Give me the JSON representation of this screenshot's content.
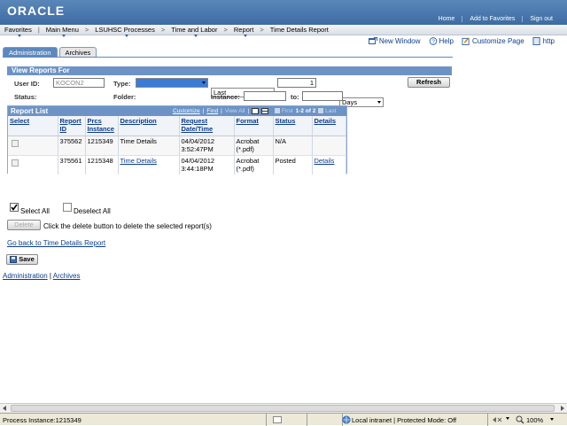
{
  "banner": {
    "logo": "ORACLE",
    "links": [
      "Home",
      "Add to Favorites",
      "Sign out"
    ]
  },
  "menu": {
    "items": [
      "Favorites",
      "Main Menu",
      "LSUHSC Processes",
      "Time and Labor",
      "Report",
      "Time Details Report"
    ]
  },
  "toplinks": {
    "new_window": "New Window",
    "help": "Help",
    "customize": "Customize Page",
    "http": "http"
  },
  "tabs": {
    "administration": "Administration",
    "archives": "Archives"
  },
  "filter": {
    "title": "View Reports For",
    "user_id_label": "User ID:",
    "user_id_value": "KOCON2",
    "type_label": "Type:",
    "type_value": "",
    "last_value": "Last",
    "days_count": "1",
    "days_unit": "Days",
    "refresh": "Refresh",
    "status_label": "Status:",
    "status_value": "",
    "folder_label": "Folder:",
    "folder_value": "",
    "instance_label": "Instance:",
    "instance_value": "",
    "to_label": "to:",
    "to_value": ""
  },
  "report_list": {
    "title": "Report List",
    "nav": {
      "customize": "Customize",
      "find": "Find",
      "view_all": "View All",
      "first": "First",
      "range": "1-2 of 2",
      "last": "Last"
    },
    "columns": {
      "select": "Select",
      "report_id": "Report ID",
      "prcs_instance": "Prcs Instance",
      "description": "Description",
      "request_datetime": "Request Date/Time",
      "format": "Format",
      "status": "Status",
      "details": "Details"
    },
    "rows": [
      {
        "report_id": "375562",
        "prcs_instance": "1215349",
        "description": "Time Details",
        "request_date": "04/04/2012",
        "request_time": "3:52:47PM",
        "format_1": "Acrobat",
        "format_2": "(*.pdf)",
        "status": "N/A",
        "details": ""
      },
      {
        "report_id": "375561",
        "prcs_instance": "1215348",
        "description": "Time Details",
        "request_date": "04/04/2012",
        "request_time": "3:44:18PM",
        "format_1": "Acrobat",
        "format_2": "(*.pdf)",
        "status": "Posted",
        "details": "Details"
      }
    ]
  },
  "actions": {
    "select_all": "Select All",
    "deselect_all": "Deselect All",
    "delete": "Delete",
    "delete_hint": "Click the delete button to delete the selected report(s)",
    "go_back": "Go back to Time Details Report",
    "save": "Save",
    "bottom_admin": "Administration",
    "bottom_sep": "|",
    "bottom_archives": "Archives"
  },
  "statusbar": {
    "process": "Process Instance:1215349",
    "zone": "Local intranet | Protected Mode: Off",
    "zoom": "100%"
  }
}
